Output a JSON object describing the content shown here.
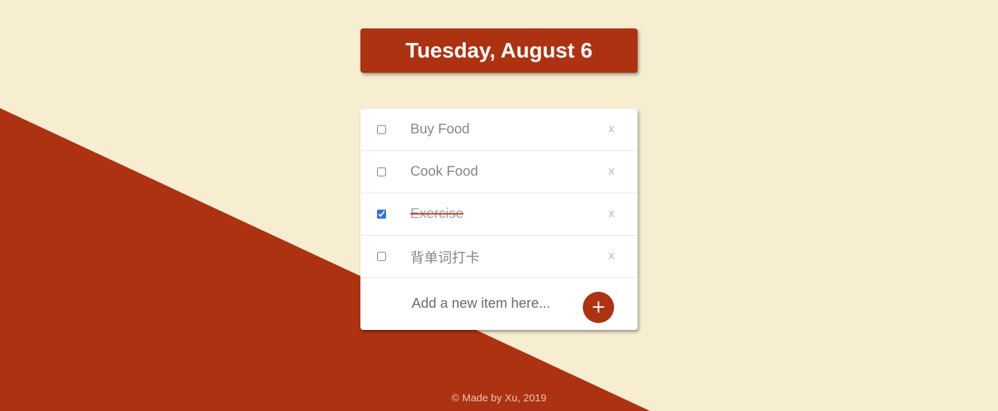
{
  "colors": {
    "background": "#f7eed2",
    "accent": "#ad3211",
    "card": "#ffffff",
    "checkbox_checked": "#2f6fe0"
  },
  "header": {
    "title": "Tuesday, August 6"
  },
  "todo": {
    "items": [
      {
        "label": "Buy Food",
        "checked": false,
        "remove_label": "x"
      },
      {
        "label": "Cook Food",
        "checked": false,
        "remove_label": "x"
      },
      {
        "label": "Exercise",
        "checked": true,
        "remove_label": "x"
      },
      {
        "label": "背单词打卡",
        "checked": false,
        "remove_label": "x"
      }
    ],
    "new_item": {
      "placeholder": "Add a new item here...",
      "value": "",
      "add_label": "+"
    }
  },
  "footer": {
    "text": "© Made by Xu, 2019"
  }
}
